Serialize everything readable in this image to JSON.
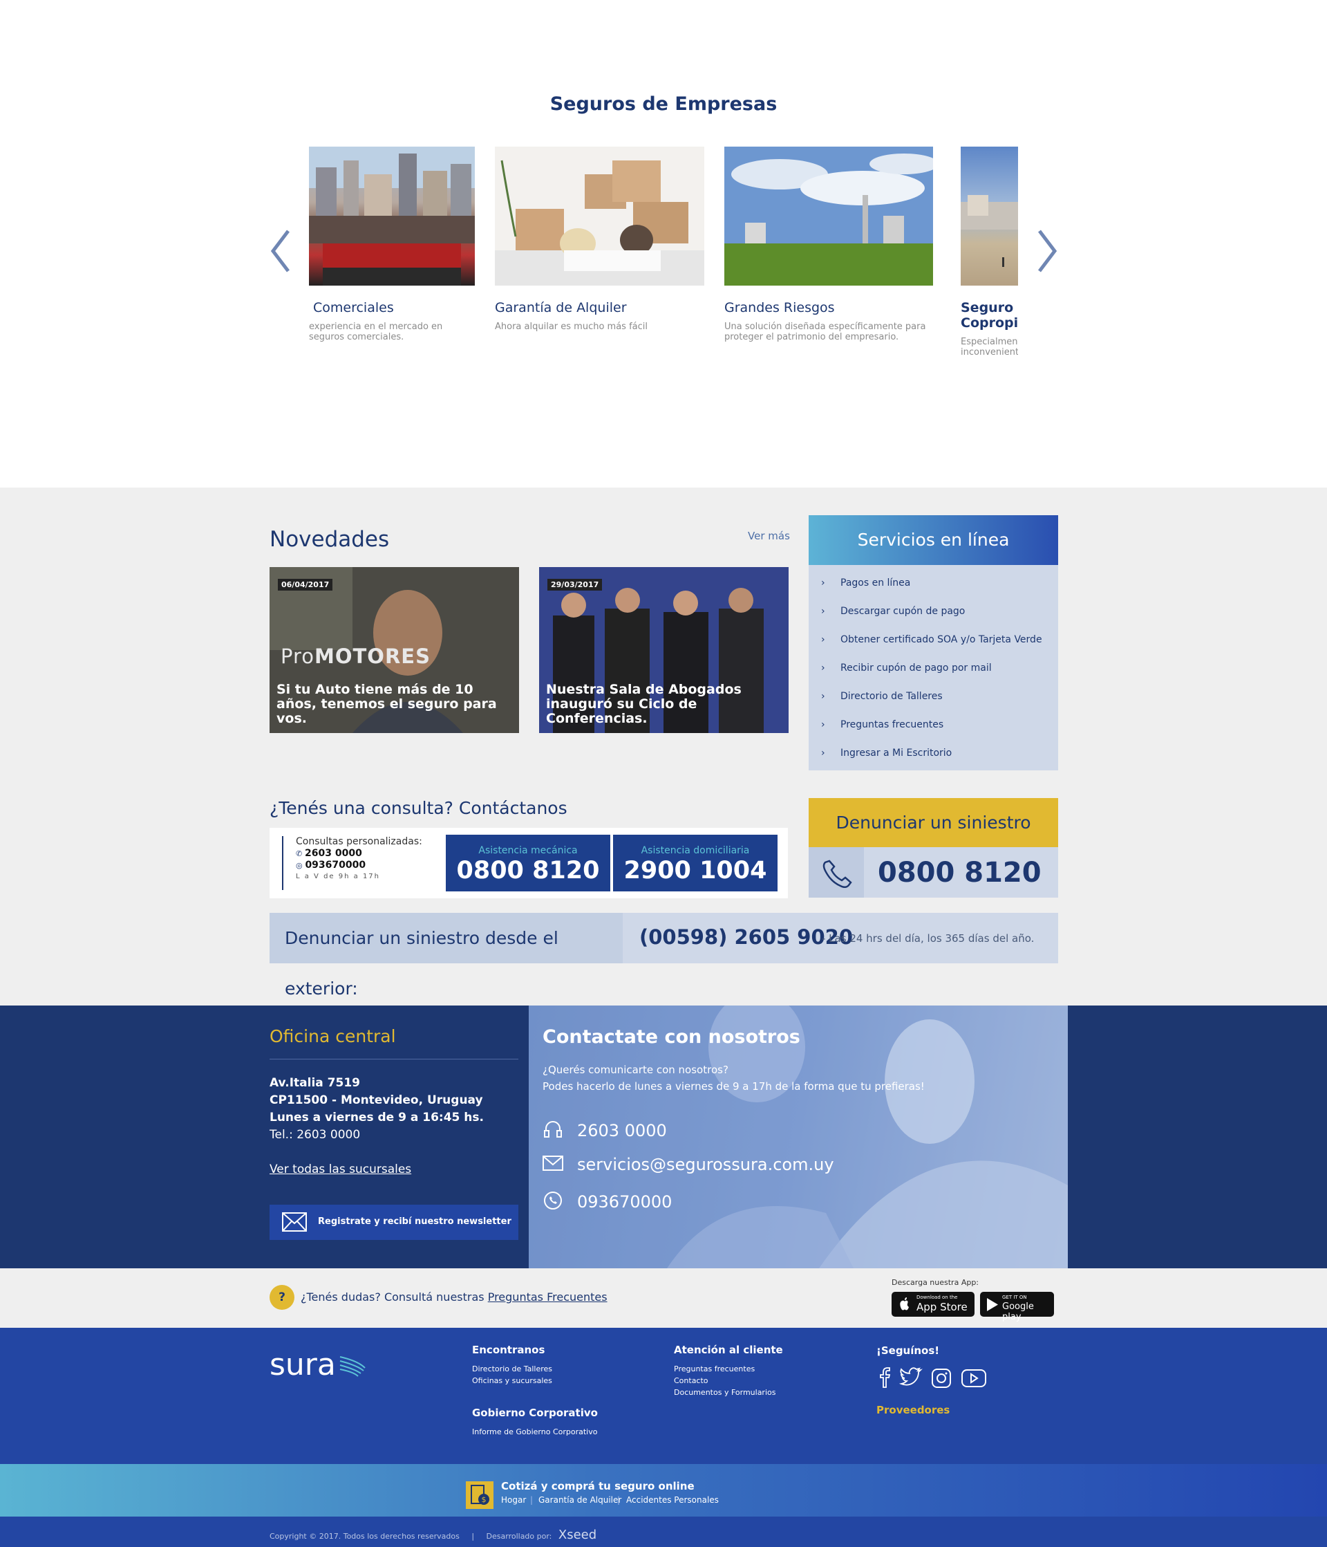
{
  "empresas": {
    "title": "Seguros de Empresas",
    "cards": [
      {
        "title": "Comerciales",
        "desc": "experiencia en el mercado en seguros comerciales."
      },
      {
        "title": "Garantía de Alquiler",
        "desc": "Ahora alquilar es mucho más fácil"
      },
      {
        "title": "Grandes Riesgos",
        "desc": "Una solución diseñada específicamente para proteger el patrimonio del empresario."
      },
      {
        "title": "Seguro In Copropie",
        "desc": "Especialment inconveniente"
      }
    ]
  },
  "novedades": {
    "title": "Novedades",
    "ver_mas": "Ver más",
    "items": [
      {
        "date": "06/04/2017",
        "promo_a": "Pro",
        "promo_b": "MOTORES",
        "headline": "Si tu Auto tiene más de 10 años, tenemos el seguro para vos."
      },
      {
        "date": "29/03/2017",
        "headline": "Nuestra Sala de Abogados inauguró su Ciclo de Conferencias."
      }
    ]
  },
  "servicios": {
    "title": "Servicios en línea",
    "items": [
      "Pagos en línea",
      "Descargar cupón de pago",
      "Obtener certificado SOA y/o Tarjeta Verde",
      "Recibir cupón de pago por mail",
      "Directorio de Talleres",
      "Preguntas frecuentes",
      "Ingresar a Mi Escritorio"
    ]
  },
  "consulta": {
    "title": "¿Tenés una consulta? Contáctanos",
    "personalizadas": "Consultas personalizadas:",
    "phone1": "2603 0000",
    "phone2": "093670000",
    "horario": "L a V de 9h a 17h",
    "mecanica_label": "Asistencia mecánica",
    "mecanica_num": "0800 8120",
    "domiciliaria_label": "Asistencia domiciliaria",
    "domiciliaria_num": "2900 1004"
  },
  "denunciar": {
    "title": "Denunciar un siniestro",
    "number": "0800 8120"
  },
  "exterior": {
    "label": "Denunciar un siniestro desde el exterior:",
    "number": "(00598) 2605 9020",
    "note": "- Las 24 hrs del día, los 365 días del año."
  },
  "oficina": {
    "title": "Oficina central",
    "lines": [
      "Av.Italia 7519",
      "CP11500 - Montevideo, Uruguay",
      "Lunes a viernes de 9 a 16:45 hs.",
      "Tel.: 2603 0000"
    ],
    "link": "Ver todas las sucursales",
    "newsletter": "Registrate y recibí nuestro newsletter"
  },
  "contacto": {
    "title": "Contactate con nosotros",
    "sub1": "¿Querés comunicarte con nosotros?",
    "sub2": "Podes hacerlo de lunes a viernes de 9 a 17h de la forma que tu prefieras!",
    "phone": "2603 0000",
    "email": "servicios@segurossura.com.uy",
    "whatsapp": "093670000"
  },
  "dudas": {
    "q": "?",
    "text": "¿Tenés dudas? Consultá nuestras ",
    "link": "Preguntas Frecuentes",
    "app_label": "Descarga nuestra App:",
    "appstore_small": "Download on the",
    "appstore": "App Store",
    "googleplay_small": "GET IT ON",
    "googleplay": "Google play"
  },
  "footer": {
    "logo": "sura",
    "encontranos": "Encontranos",
    "encontranos_links": [
      "Directorio de Talleres",
      "Oficinas y sucursales"
    ],
    "gobierno": "Gobierno Corporativo",
    "gobierno_links": [
      "Informe de Gobierno Corporativo"
    ],
    "atencion": "Atención al cliente",
    "atencion_links": [
      "Preguntas frecuentes",
      "Contacto",
      "Documentos y Formularios"
    ],
    "seguinos": "¡Seguínos!",
    "proveedores": "Proveedores"
  },
  "cotiza": {
    "title": "Cotizá y comprá tu seguro online",
    "links": [
      "Hogar",
      "Garantía de Alquiler",
      "Accidentes Personales"
    ]
  },
  "copyright": {
    "text": "Copyright © 2017. Todos los derechos reservados",
    "dev": "Desarrollado por:",
    "dev_name": "Xseed"
  },
  "colors": {
    "navy": "#1d3770",
    "blue": "#2346a3",
    "gold": "#e1b931",
    "grey": "#efefef"
  }
}
